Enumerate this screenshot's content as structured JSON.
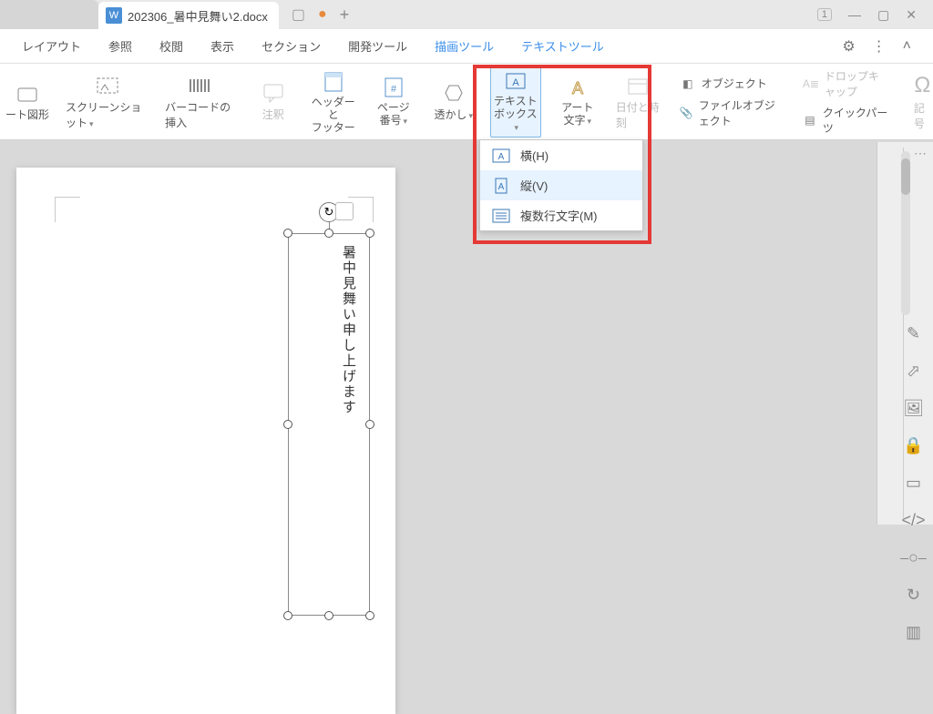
{
  "titlebar": {
    "doc_title": "202306_暑中見舞い2.docx"
  },
  "ribbon_tabs": [
    {
      "label": "レイアウト"
    },
    {
      "label": "参照"
    },
    {
      "label": "校閲"
    },
    {
      "label": "表示"
    },
    {
      "label": "セクション"
    },
    {
      "label": "開発ツール"
    },
    {
      "label": "描画ツール",
      "tool": true
    },
    {
      "label": "テキストツール",
      "tool": true
    }
  ],
  "ribbon": {
    "smartart": {
      "l1": "ート図形"
    },
    "screenshot": {
      "l1": "スクリーンショット"
    },
    "barcode": {
      "l1": "バーコードの挿入"
    },
    "comment": {
      "l1": "注釈"
    },
    "headerfooter": {
      "l1": "ヘッダーと",
      "l2": "フッター"
    },
    "pagenum": {
      "l1": "ページ",
      "l2": "番号"
    },
    "watermark": {
      "l1": "透かし"
    },
    "textbox": {
      "l1": "テキスト",
      "l2": "ボックス"
    },
    "wordart": {
      "l1": "アート",
      "l2": "文字"
    },
    "datetime": {
      "l1": "日付と時刻"
    },
    "right": {
      "object": "オブジェクト",
      "fileobject": "ファイルオブジェクト",
      "dropcap": "ドロップキャップ",
      "quickparts": "クイックパーツ"
    },
    "symbol": "記号"
  },
  "dropdown": {
    "horiz": "横(H)",
    "vert": "縦(V)",
    "multi": "複数行文字(M)"
  },
  "document": {
    "vertical_text": "暑中見舞い申し上げます"
  }
}
